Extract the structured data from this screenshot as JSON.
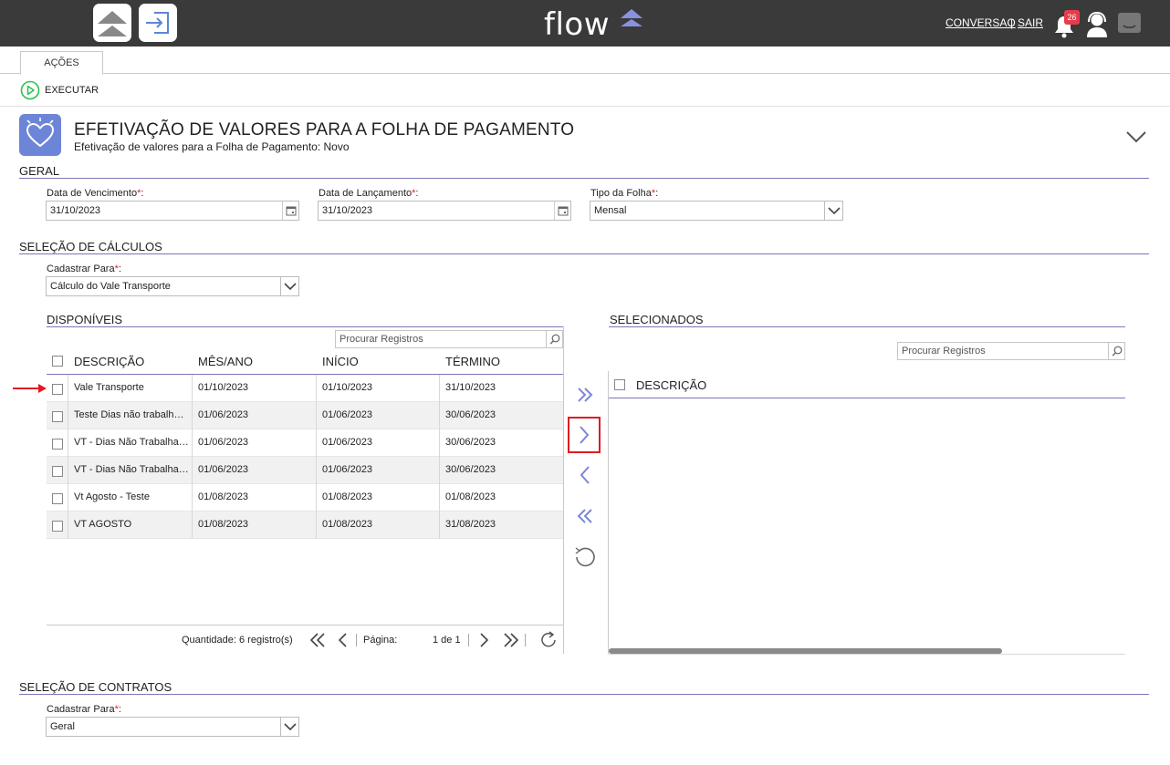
{
  "header": {
    "logo_text": "flow",
    "links": {
      "conversao": "CONVERSAO",
      "separator": "|",
      "sair": "SAIR"
    },
    "notifications_count": "26",
    "icons": [
      "cloud-upload-icon",
      "login-icon",
      "bell-icon",
      "support-agent-icon",
      "chat-icon"
    ]
  },
  "tabs": [
    {
      "label": "AÇÕES"
    }
  ],
  "toolbar": {
    "execute_label": "EXECUTAR"
  },
  "page": {
    "title": "EFETIVAÇÃO DE VALORES PARA A FOLHA DE PAGAMENTO",
    "subtitle": "Efetivação de valores para a Folha de Pagamento: Novo"
  },
  "geral": {
    "section_title": "GERAL",
    "data_vencimento": {
      "label": "Data de Vencimento",
      "value": "31/10/2023"
    },
    "data_lancamento": {
      "label": "Data de Lançamento",
      "value": "31/10/2023"
    },
    "tipo_folha": {
      "label": "Tipo da Folha",
      "value": "Mensal"
    },
    "required_mark": "*",
    "label_suffix": ":"
  },
  "selecao_calculos": {
    "section_title": "SELEÇÃO DE CÁLCULOS",
    "cadastrar_para": {
      "label": "Cadastrar Para",
      "value": "Cálculo do Vale Transporte"
    },
    "disponiveis": {
      "title": "DISPONÍVEIS",
      "search_placeholder": "Procurar Registros",
      "columns": [
        "DESCRIÇÃO",
        "MÊS/ANO",
        "INÍCIO",
        "TÉRMINO"
      ],
      "rows": [
        {
          "descricao": "Vale Transporte",
          "mes_ano": "01/10/2023",
          "inicio": "01/10/2023",
          "termino": "31/10/2023"
        },
        {
          "descricao": "Teste Dias não trabalhados",
          "mes_ano": "01/06/2023",
          "inicio": "01/06/2023",
          "termino": "30/06/2023"
        },
        {
          "descricao": "VT - Dias Não Trabalhados",
          "mes_ano": "01/06/2023",
          "inicio": "01/06/2023",
          "termino": "30/06/2023"
        },
        {
          "descricao": "VT - Dias Não Trabalhados",
          "mes_ano": "01/06/2023",
          "inicio": "01/06/2023",
          "termino": "30/06/2023"
        },
        {
          "descricao": "Vt Agosto - Teste",
          "mes_ano": "01/08/2023",
          "inicio": "01/08/2023",
          "termino": "01/08/2023"
        },
        {
          "descricao": "VT AGOSTO",
          "mes_ano": "01/08/2023",
          "inicio": "01/08/2023",
          "termino": "31/08/2023"
        }
      ],
      "pager": {
        "quantity": "Quantidade: 6 registro(s)",
        "page_label": "Página:",
        "page_value": "1 de 1"
      }
    },
    "selecionados": {
      "title": "SELECIONADOS",
      "search_placeholder": "Procurar Registros",
      "columns": [
        "DESCRIÇÃO"
      ]
    }
  },
  "selecao_contratos": {
    "section_title": "SELEÇÃO DE CONTRATOS",
    "cadastrar_para": {
      "label": "Cadastrar Para",
      "value": "Geral"
    }
  },
  "colors": {
    "topbar": "#3a3a3a",
    "accent": "#7a78b5",
    "transfer_icon": "#7a86d8",
    "highlight": "#e01b24",
    "execute_icon": "#2fbf4f"
  }
}
